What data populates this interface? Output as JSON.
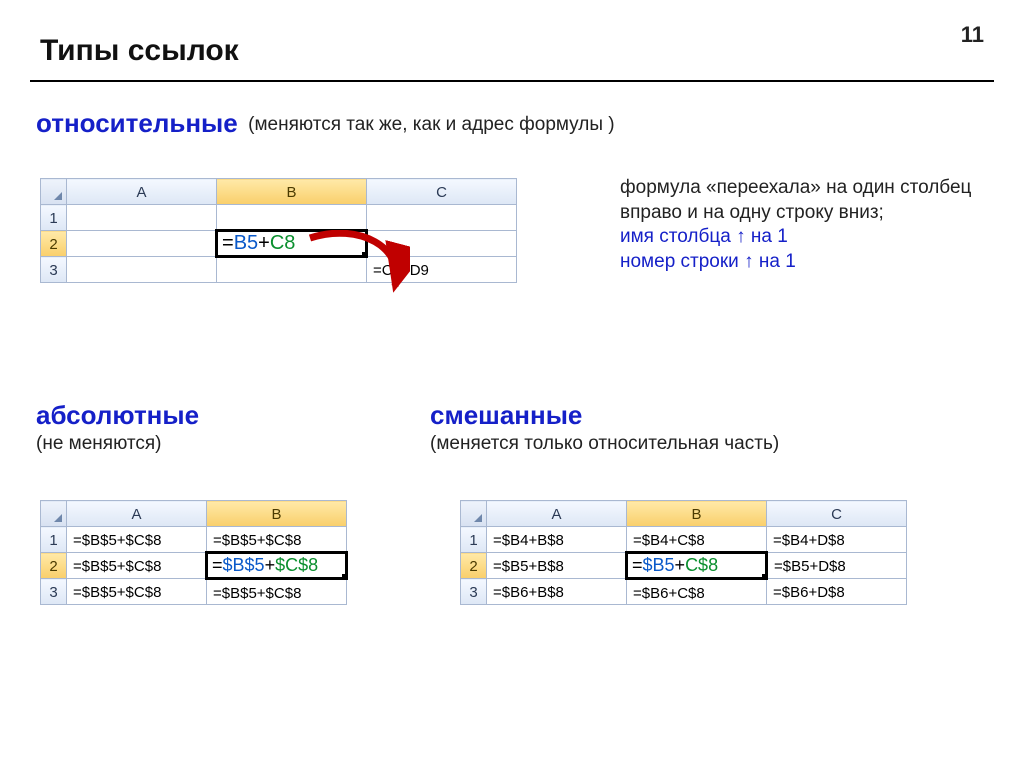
{
  "page_number": "11",
  "title": "Типы ссылок",
  "relative": {
    "heading": "относительные",
    "sub": "(меняются так же, как и адрес формулы )",
    "note_line1": "формула «переехала» на один столбец вправо и на одну строку вниз;",
    "note_line2": "имя столбца ↑ на 1",
    "note_line3": "номер строки ↑ на 1",
    "table": {
      "cols": [
        "A",
        "B",
        "C"
      ],
      "rows": [
        "1",
        "2",
        "3"
      ],
      "formula_b2_pre": "=",
      "formula_b2_ref1": "B5",
      "formula_b2_plus": "+",
      "formula_b2_ref2": "C8",
      "formula_c3": "=C6+D9"
    }
  },
  "absolute": {
    "heading": "абсолютные",
    "sub": "(не меняются)",
    "table": {
      "cols": [
        "A",
        "B"
      ],
      "rows": [
        "1",
        "2",
        "3"
      ],
      "cells": {
        "A1": "=$B$5+$C$8",
        "B1": "=$B$5+$C$8",
        "A2": "=$B$5+$C$8",
        "B2_pre": "=",
        "B2_r1": "$B$5",
        "B2_plus": "+",
        "B2_r2": "$C$8",
        "A3": "=$B$5+$C$8",
        "B3": "=$B$5+$C$8"
      }
    }
  },
  "mixed": {
    "heading": "смешанные",
    "sub": "(меняется только относительная часть)",
    "table": {
      "cols": [
        "A",
        "B",
        "C"
      ],
      "rows": [
        "1",
        "2",
        "3"
      ],
      "cells": {
        "A1": "=$B4+B$8",
        "B1": "=$B4+C$8",
        "C1": "=$B4+D$8",
        "A2": "=$B5+B$8",
        "B2_pre": "=",
        "B2_r1": "$B5",
        "B2_plus": "+",
        "B2_r2": "C$8",
        "C2": "=$B5+D$8",
        "A3": "=$B6+B$8",
        "B3": "=$B6+C$8",
        "C3": "=$B6+D$8"
      }
    }
  }
}
